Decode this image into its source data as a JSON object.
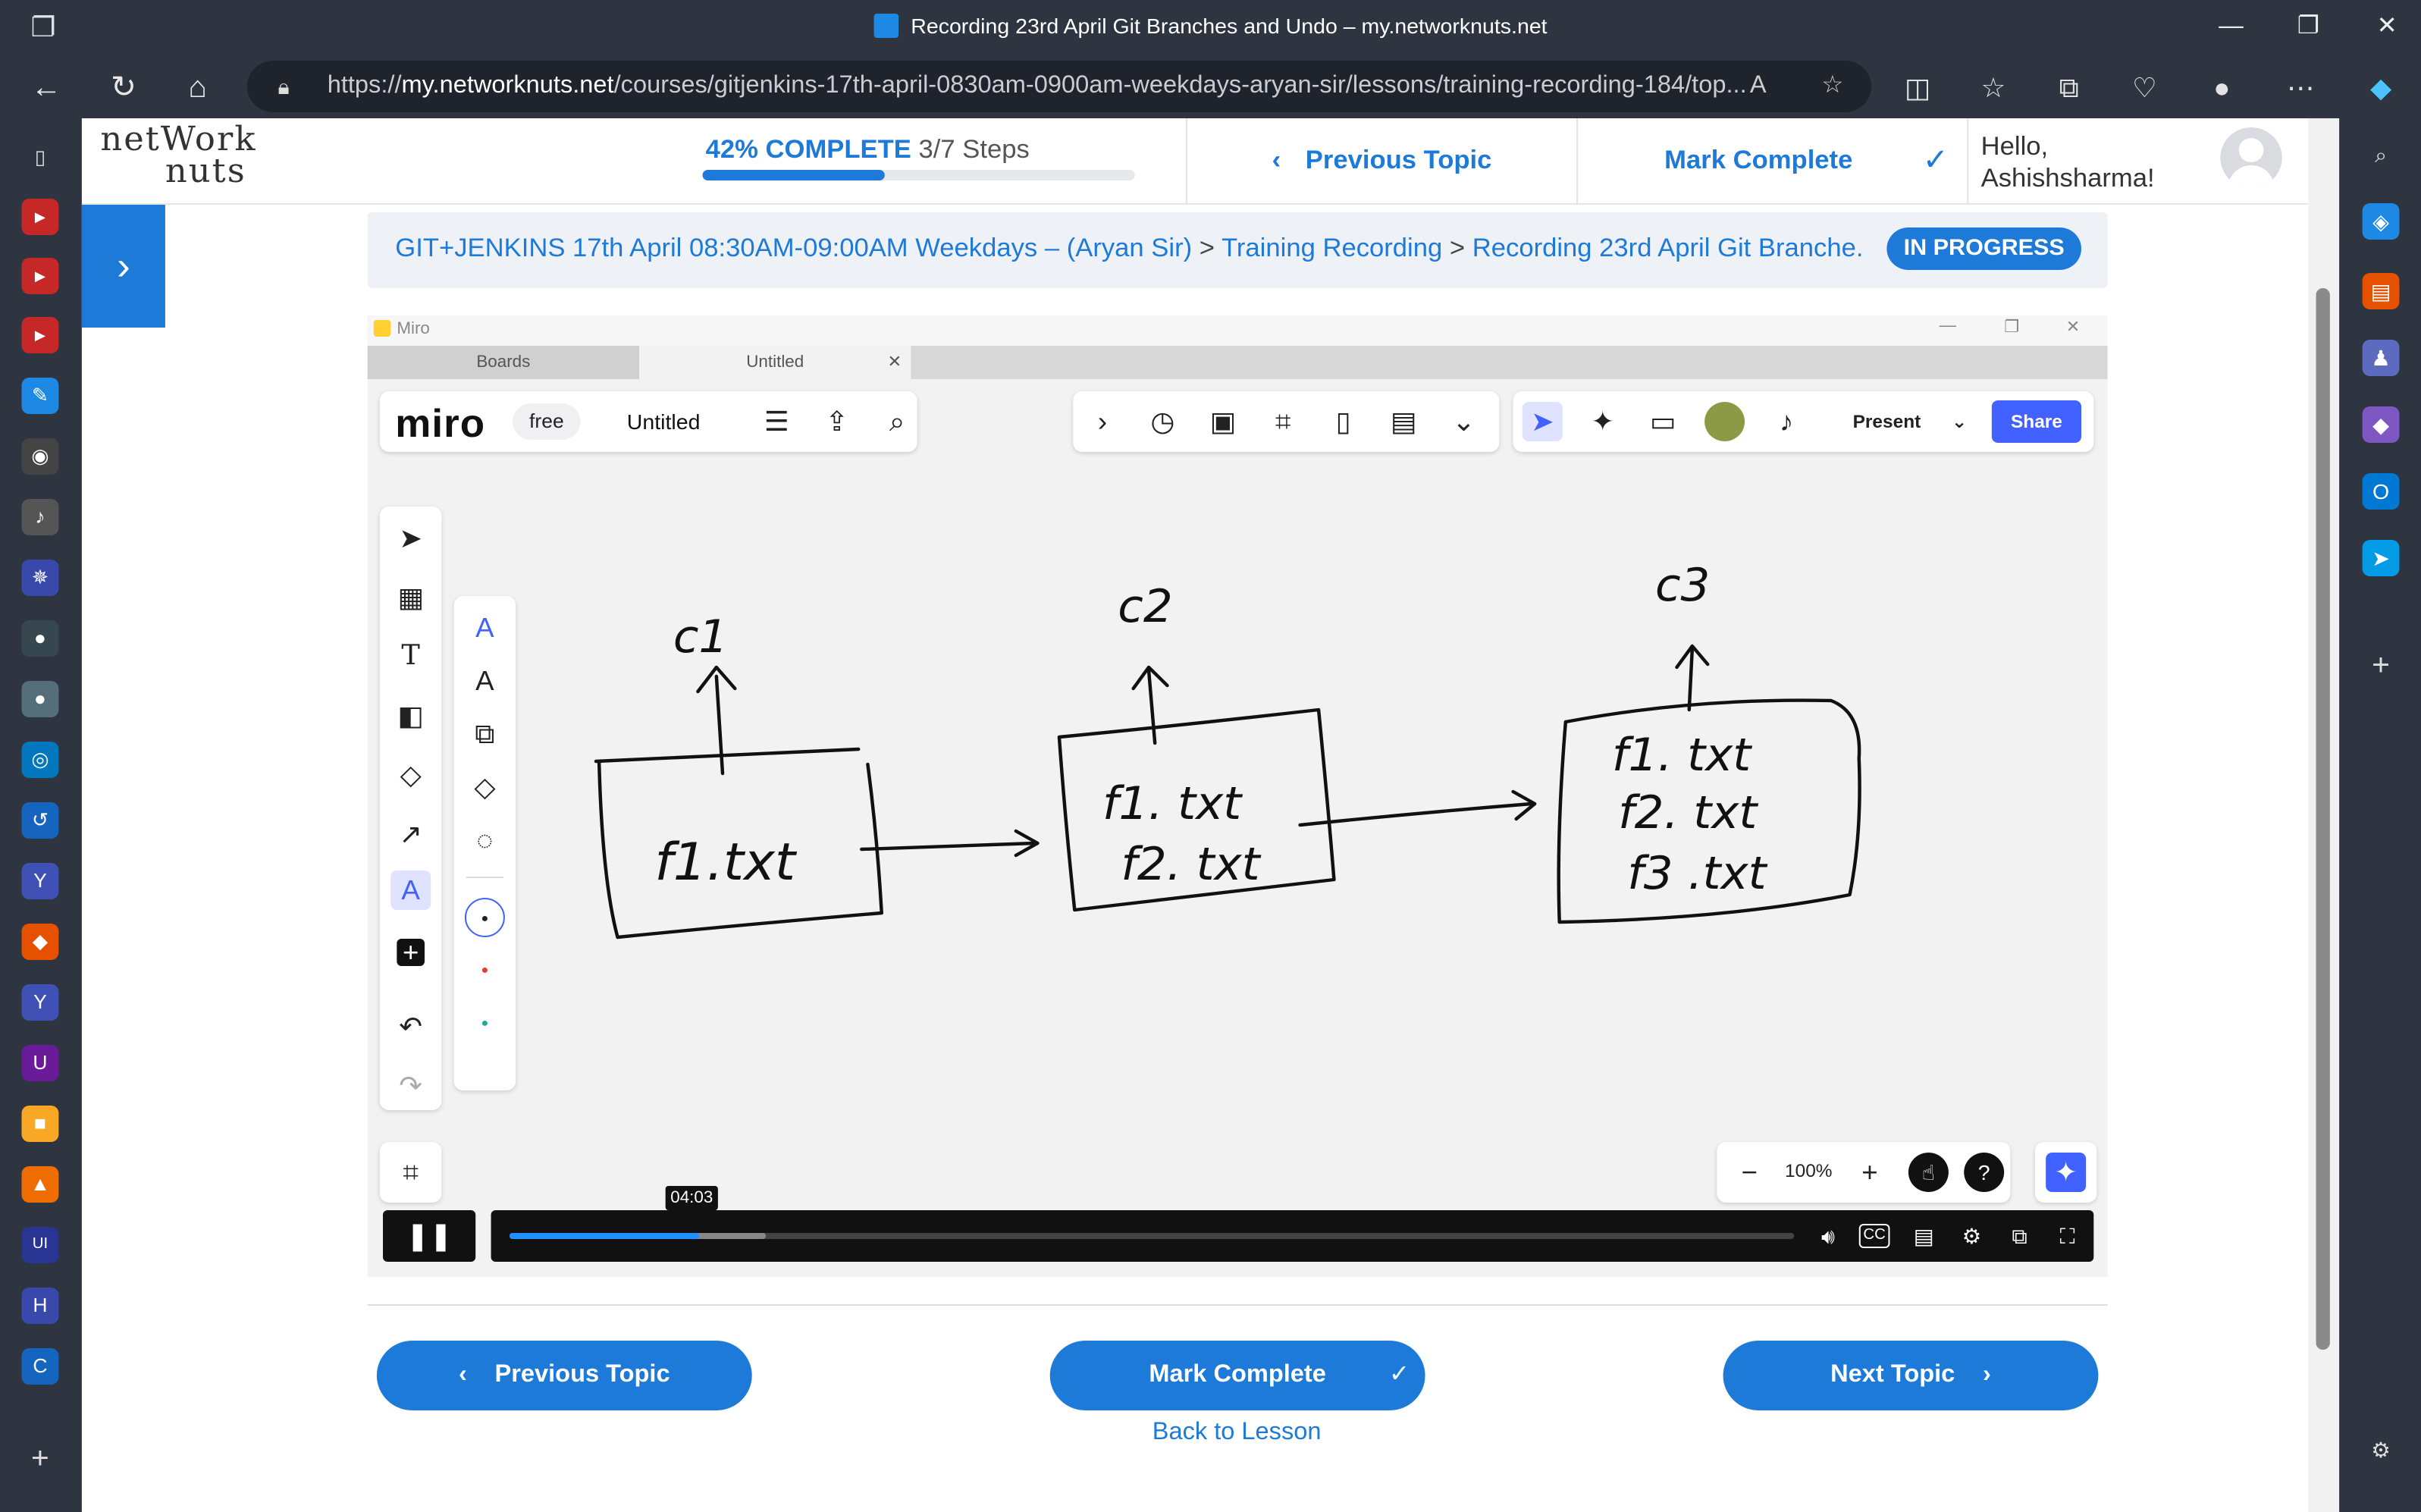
{
  "window": {
    "title": "Recording 23rd April Git Branches and Undo – my.networknuts.net",
    "url_prefix": "https://",
    "url_host": "my.networknuts.net",
    "url_path": "/courses/gitjenkins-17th-april-0830am-0900am-weekdays-aryan-sir/lessons/training-recording-184/top..."
  },
  "header": {
    "logo_line1": "netWork",
    "logo_line2": "nuts",
    "progress_percent_label": "42% COMPLETE",
    "progress_steps_label": "3/7 Steps",
    "progress_fraction": 0.42,
    "previous_topic": "Previous Topic",
    "mark_complete": "Mark Complete",
    "greeting_line1": "Hello,",
    "greeting_line2": "Ashishsharma!"
  },
  "breadcrumb": {
    "course": "GIT+JENKINS 17th April 08:30AM-09:00AM Weekdays – (Aryan Sir)",
    "lesson": "Training Recording",
    "topic": "Recording 23rd April Git Branche...",
    "sep": ">",
    "status": "IN PROGRESS"
  },
  "video": {
    "app_title": "Miro",
    "tabs": [
      "Boards",
      "Untitled"
    ],
    "brand": "miro",
    "plan": "free",
    "board_name": "Untitled",
    "present_label": "Present",
    "share_label": "Share",
    "zoom": "100%",
    "time_tooltip": "04:03",
    "played_fraction": 0.148,
    "buffered_fraction": 0.2,
    "sketch": {
      "commit_labels": [
        "c1",
        "c2",
        "c3"
      ],
      "box1": [
        "f1.txt"
      ],
      "box2": [
        "f1. txt",
        "f2. txt"
      ],
      "box3": [
        "f1. txt",
        "f2. txt",
        "f3 .txt"
      ]
    }
  },
  "footer": {
    "previous_topic": "Previous Topic",
    "mark_complete": "Mark Complete",
    "next_topic": "Next Topic",
    "back_to_lesson": "Back to Lesson"
  },
  "colors": {
    "accent": "#1e7ad8",
    "chrome_bg": "#2e3440",
    "miro_share": "#4262ff"
  }
}
